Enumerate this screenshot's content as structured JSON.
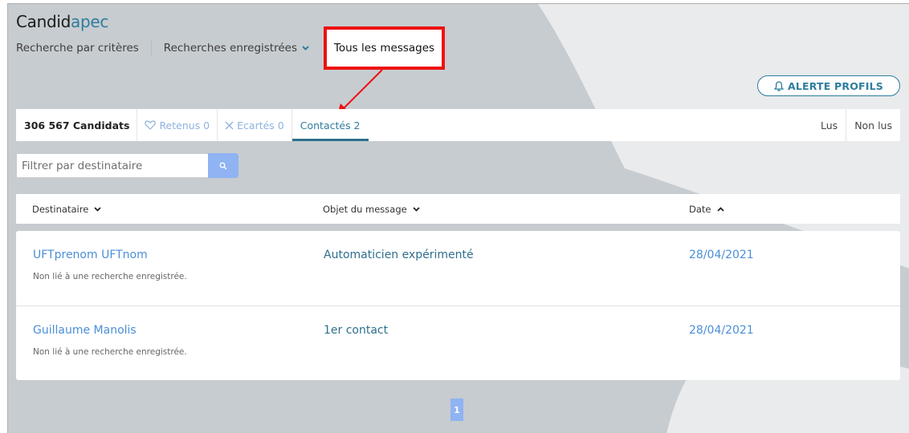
{
  "brand": {
    "part1": "Candid",
    "part2": "apec"
  },
  "topnav": {
    "criteria": "Recherche par critères",
    "saved": "Recherches enregistrées",
    "messages": "Tous les messages"
  },
  "alert_button": "ALERTE PROFILS",
  "tabs": {
    "count": "306 567 Candidats",
    "retained": "Retenus 0",
    "rejected": "Ecartés 0",
    "contacted": "Contactés 2",
    "read": "Lus",
    "unread": "Non lus"
  },
  "filter": {
    "placeholder": "Filtrer par destinataire"
  },
  "table": {
    "headers": {
      "recipient": "Destinataire",
      "subject": "Objet du message",
      "date": "Date"
    },
    "rows": [
      {
        "name": "UFTprenom UFTnom",
        "note": "Non lié à une recherche enregistrée.",
        "subject": "Automaticien expérimenté",
        "date": "28/04/2021"
      },
      {
        "name": "Guillaume Manolis",
        "note": "Non lié à une recherche enregistrée.",
        "subject": "1er contact",
        "date": "28/04/2021"
      }
    ]
  },
  "pagination": {
    "current": "1"
  },
  "colors": {
    "accent": "#2e7d9e",
    "link": "#4a8fd8",
    "highlight_box": "#ee1111",
    "button_blue": "#8fb3f3"
  }
}
